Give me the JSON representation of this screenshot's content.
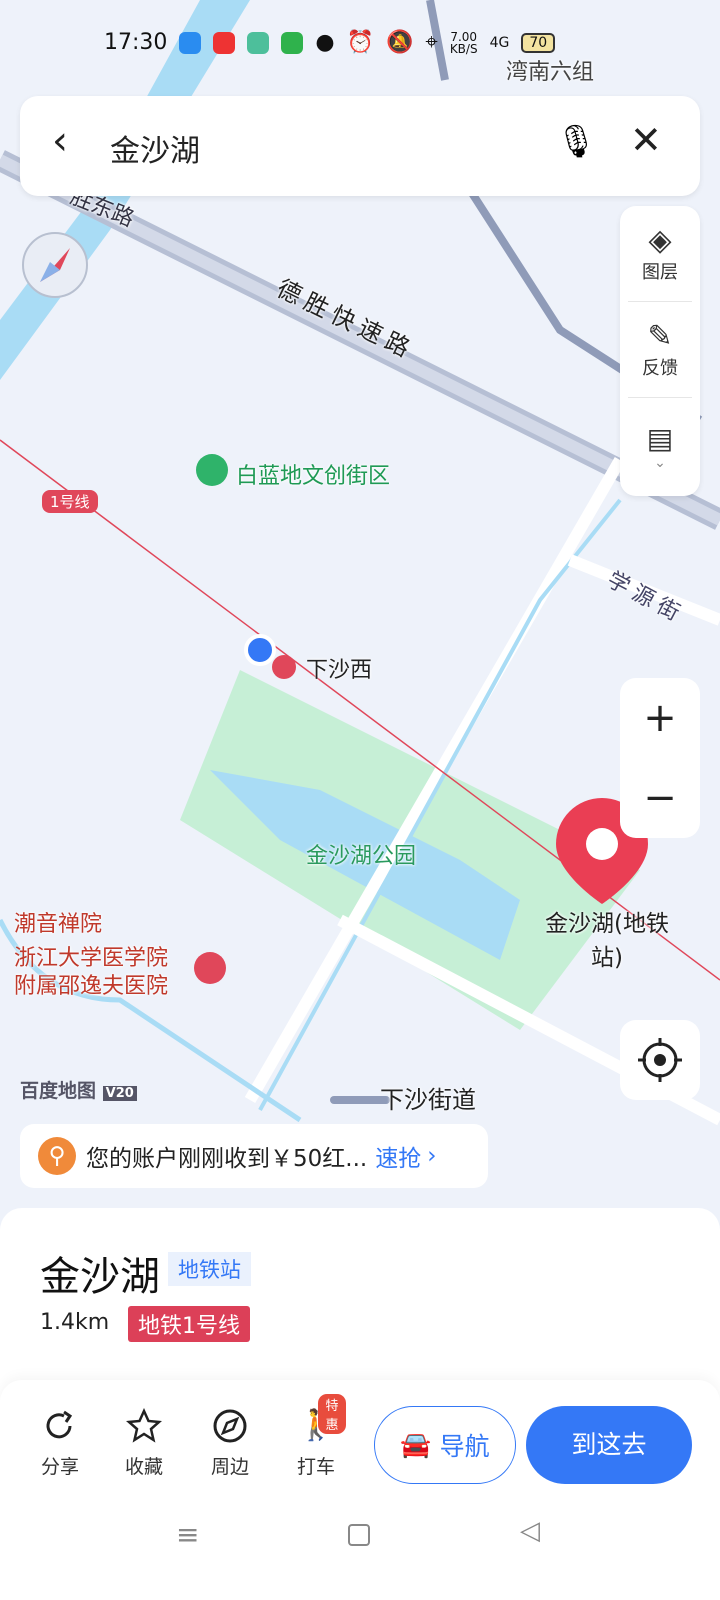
{
  "status": {
    "time": "17:30",
    "speed": "7.00",
    "speed_unit": "KB/S",
    "network": "4G",
    "battery": "70"
  },
  "search": {
    "query": "金沙湖"
  },
  "tools": [
    {
      "label": "图层",
      "icon": "layers-icon"
    },
    {
      "label": "反馈",
      "icon": "edit-icon"
    },
    {
      "label": "",
      "icon": "message-icon"
    }
  ],
  "map": {
    "labels": {
      "area_top": "湾南六组",
      "road1": "胜东路",
      "road2": "德胜快速路",
      "poi1": "白蓝地文创街区",
      "line": "1号线",
      "road3": "学源街",
      "station": "下沙西",
      "park": "金沙湖公园",
      "poi2": "潮音禅院",
      "hospital1": "浙江大学医学院",
      "hospital2": "附属邵逸夫医院",
      "dest": "金沙湖(地铁站)",
      "street": "下沙街道",
      "logo": "百度地图",
      "logo_ver": "V20"
    },
    "colors": {
      "water": "#a9dcf5",
      "park": "#c6efd6",
      "metro": "#e0475a",
      "accent": "#3478f6"
    }
  },
  "promo": {
    "text": "您的账户刚刚收到￥50红...",
    "action": "速抢"
  },
  "place": {
    "name": "金沙湖",
    "type": "地铁站",
    "distance": "1.4km",
    "line": "地铁1号线"
  },
  "actions": [
    {
      "label": "分享",
      "icon": "share-icon"
    },
    {
      "label": "收藏",
      "icon": "star-icon"
    },
    {
      "label": "周边",
      "icon": "compass-icon"
    },
    {
      "label": "打车",
      "icon": "taxi-icon",
      "badge": "特惠"
    }
  ],
  "buttons": {
    "nav": "导航",
    "go": "到这去"
  }
}
